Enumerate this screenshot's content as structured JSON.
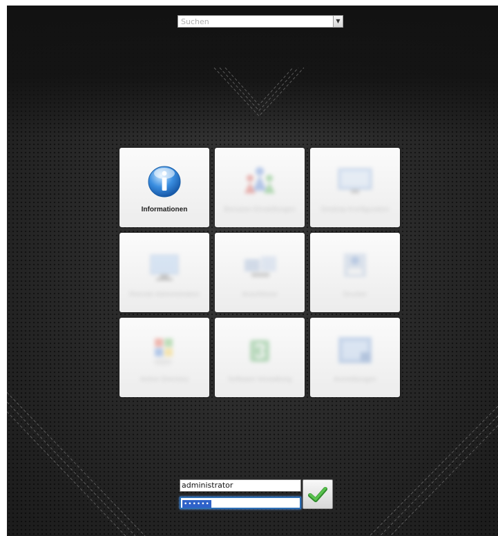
{
  "search": {
    "placeholder": "Suchen"
  },
  "tiles": [
    {
      "label": "Informationen",
      "icon": "info-icon",
      "active": true
    },
    {
      "label": "Benutzer-Einstellungen",
      "icon": "users-icon",
      "active": false
    },
    {
      "label": "Desktop-Konfiguration",
      "icon": "desktop-icon",
      "active": false
    },
    {
      "label": "Remote-Administration",
      "icon": "monitor-icon",
      "active": false
    },
    {
      "label": "Anschlüsse",
      "icon": "network-icon",
      "active": false
    },
    {
      "label": "Drucker",
      "icon": "printer-icon",
      "active": false
    },
    {
      "label": "Active Directory",
      "icon": "windows-icon",
      "active": false
    },
    {
      "label": "Software-Verwaltung",
      "icon": "software-icon",
      "active": false
    },
    {
      "label": "Anmeldungen",
      "icon": "login-icon",
      "active": false
    }
  ],
  "login": {
    "username": "administrator",
    "password_mask": "••••••",
    "submit_icon": "checkmark-icon"
  },
  "colors": {
    "accent_blue": "#2f62c9",
    "checkmark_green": "#3da535",
    "background_dark": "#2a2a2a"
  }
}
